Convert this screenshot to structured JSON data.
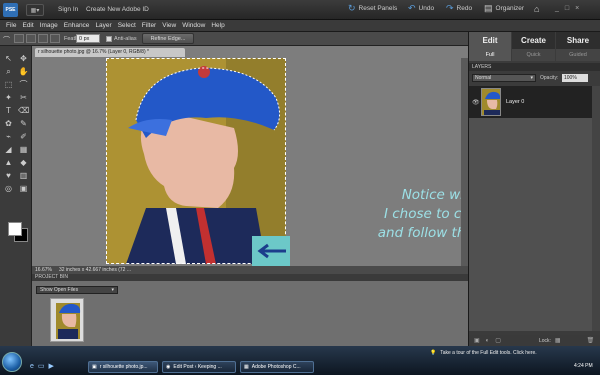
{
  "topbar": {
    "logo": "PSE",
    "signin": "Sign In",
    "create_id": "Create New Adobe ID",
    "reset_panels": "Reset Panels",
    "undo": "Undo",
    "redo": "Redo",
    "organizer": "Organizer"
  },
  "menu": [
    "File",
    "Edit",
    "Image",
    "Enhance",
    "Layer",
    "Select",
    "Filter",
    "View",
    "Window",
    "Help"
  ],
  "options": {
    "feather_label": "Feather:",
    "feather_value": "0 px",
    "antialias": "Anti-alias",
    "refine": "Refine Edge..."
  },
  "document": {
    "tab": "r silhouette photo.jpg @ 16.7% (Layer 0, RGB/8) *",
    "zoom": "16.67%",
    "size": "32 inches x 42.667 inches (72 ..."
  },
  "annotation": [
    "Notice when I was lassoing",
    "I chose to cut off his shoulder",
    "and follow the line of his neck."
  ],
  "bin": {
    "header": "PROJECT BIN",
    "select": "Show Open Files"
  },
  "panel": {
    "tabs": [
      "Edit",
      "Create",
      "Share"
    ],
    "subtabs": [
      "Full",
      "Quick",
      "Guided"
    ],
    "layers_header": "LAYERS",
    "blend": "Normal",
    "opacity_label": "Opacity:",
    "opacity": "100%",
    "layer_name": "Layer 0",
    "lock": "Lock:"
  },
  "taskbar": {
    "tour": "Take a tour of the Full Edit tools. Click here.",
    "tasks": [
      "r silhouette photo.jp...",
      "Edit Post ‹ Keeping ...",
      "Adobe Photoshop C..."
    ],
    "clock": "4:24 PM"
  },
  "colors": {
    "accent": "#2f6fb5",
    "annotation": "#9ce0e6"
  }
}
